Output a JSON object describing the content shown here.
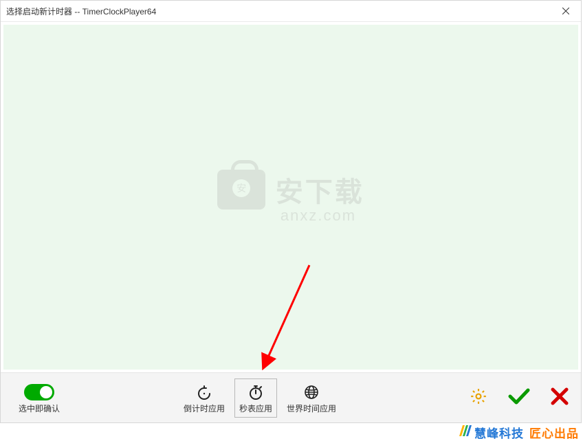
{
  "window": {
    "title": "选择启动新计时器 -- TimerClockPlayer64"
  },
  "watermark": {
    "text_big": "安下载",
    "text_small": "anxz.com"
  },
  "footer": {
    "toggle_label": "选中即确认",
    "countdown_label": "倒计时应用",
    "stopwatch_label": "秒表应用",
    "worldtime_label": "世界时间应用"
  },
  "branding": {
    "part_a": "慧峰科技",
    "part_b": "匠心出品"
  }
}
